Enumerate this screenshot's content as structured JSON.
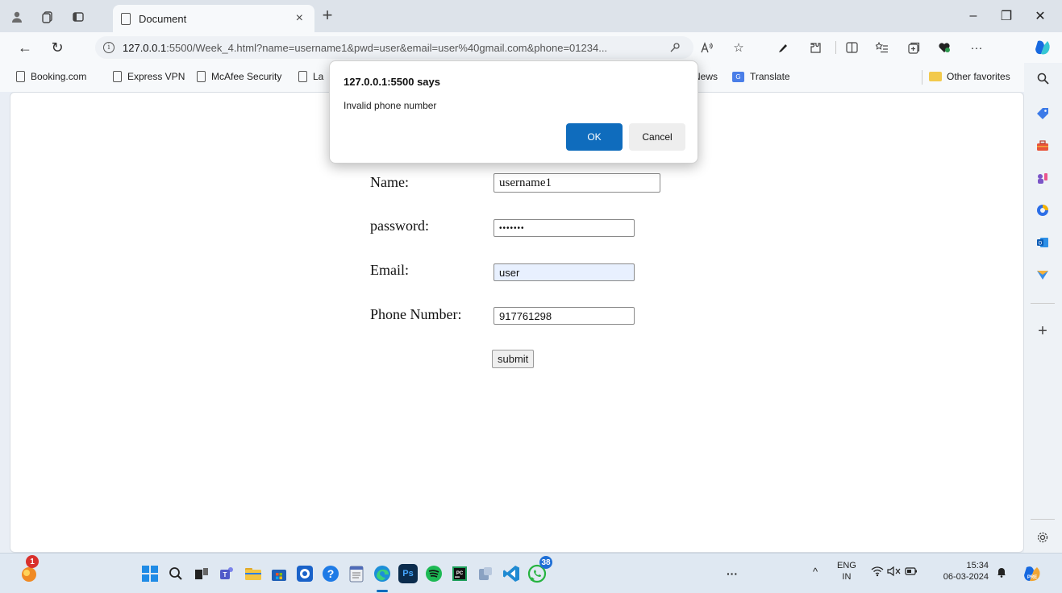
{
  "browser": {
    "tab": {
      "title": "Document",
      "close": "×"
    },
    "new_tab": "+",
    "window_controls": {
      "minimize": "–",
      "restore": "❐",
      "close": "✕"
    },
    "address_bar": {
      "host": "127.0.0.1",
      "rest": ":5500/Week_4.html?name=username1&pwd=user&email=user%40gmail.com&phone=01234..."
    },
    "more": "···"
  },
  "favorites": {
    "items": [
      "Booking.com",
      "Express VPN",
      "McAfee Security",
      "La"
    ],
    "items_right": [
      "News",
      "Translate"
    ],
    "other_favorites": "Other favorites"
  },
  "dialog": {
    "title": "127.0.0.1:5500 says",
    "message": "Invalid phone number",
    "ok_label": "OK",
    "cancel_label": "Cancel"
  },
  "form": {
    "name_label": "Name:",
    "name_value": "username1",
    "password_label": "password:",
    "password_value": "•••••••",
    "email_label": "Email:",
    "email_value": "user",
    "phone_label": "Phone Number:",
    "phone_value": "917761298",
    "submit_label": "submit"
  },
  "taskbar": {
    "notification_badge": "1",
    "whatsapp_badge": "38",
    "more": "···",
    "language": "ENG",
    "region": "IN",
    "time": "15:34",
    "date": "06-03-2024"
  },
  "colors": {
    "accent": "#0f6cbd",
    "autofill": "#e8f0fe"
  }
}
